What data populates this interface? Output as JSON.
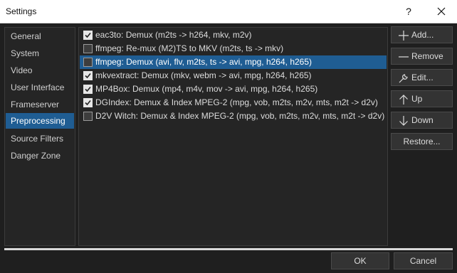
{
  "window": {
    "title": "Settings",
    "help_glyph": "?"
  },
  "nav": {
    "items": [
      {
        "label": "General"
      },
      {
        "label": "System"
      },
      {
        "label": "Video"
      },
      {
        "label": "User Interface"
      },
      {
        "label": "Frameserver"
      },
      {
        "label": "Preprocessing",
        "active": true
      },
      {
        "label": "Source Filters"
      },
      {
        "label": "Danger Zone"
      }
    ]
  },
  "list": {
    "rows": [
      {
        "label": "eac3to: Demux (m2ts -> h264, mkv, m2v)",
        "checked": true
      },
      {
        "label": "ffmpeg: Re-mux (M2)TS to MKV (m2ts, ts -> mkv)",
        "checked": false
      },
      {
        "label": "ffmpeg: Demux (avi, flv, m2ts, ts -> avi, mpg, h264, h265)",
        "checked": false,
        "selected": true
      },
      {
        "label": "mkvextract: Demux (mkv, webm -> avi, mpg, h264, h265)",
        "checked": true
      },
      {
        "label": "MP4Box: Demux (mp4, m4v, mov -> avi, mpg, h264, h265)",
        "checked": true
      },
      {
        "label": "DGIndex: Demux & Index MPEG-2 (mpg, vob, m2ts, m2v, mts, m2t -> d2v)",
        "checked": true
      },
      {
        "label": "D2V Witch: Demux & Index MPEG-2 (mpg, vob, m2ts, m2v, mts, m2t -> d2v)",
        "checked": false
      }
    ]
  },
  "side_buttons": {
    "add": {
      "label": "Add...",
      "icon": "plus-icon"
    },
    "remove": {
      "label": "Remove",
      "icon": "minus-icon"
    },
    "edit": {
      "label": "Edit...",
      "icon": "wrench-icon"
    },
    "up": {
      "label": "Up",
      "icon": "arrow-up-icon"
    },
    "down": {
      "label": "Down",
      "icon": "arrow-down-icon"
    },
    "restore": {
      "label": "Restore..."
    }
  },
  "footer": {
    "ok_label": "OK",
    "cancel_label": "Cancel"
  },
  "colors": {
    "accent": "#1f5d93",
    "background": "#1f1f1f",
    "panel": "#252525",
    "titlebar": "#ffffff"
  }
}
